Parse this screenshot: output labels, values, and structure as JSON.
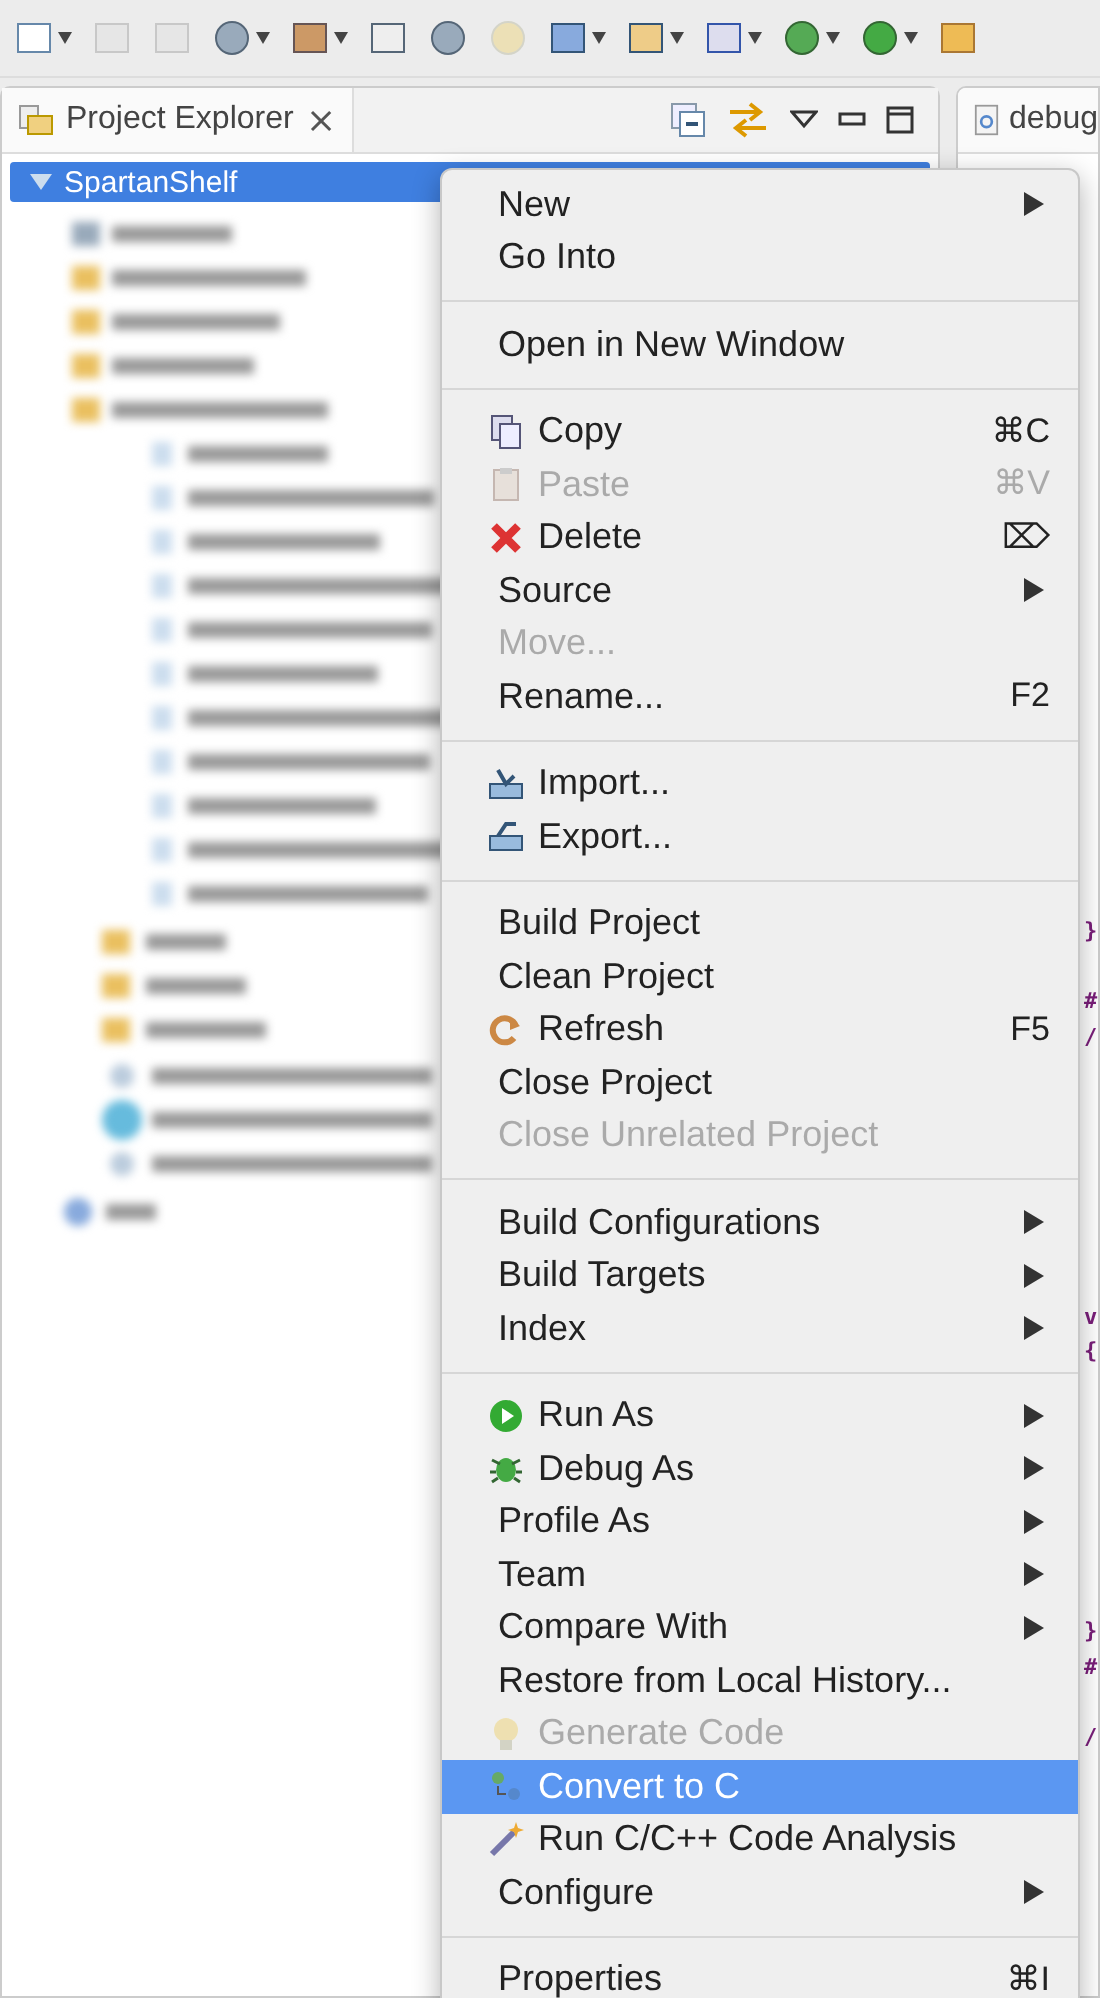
{
  "toolbar": [
    {
      "dropdown": true,
      "disabled": false
    },
    {
      "dropdown": false,
      "disabled": true
    },
    {
      "dropdown": false,
      "disabled": true
    },
    {
      "dropdown": true,
      "disabled": false
    },
    {
      "dropdown": true,
      "disabled": false
    },
    {
      "dropdown": false,
      "disabled": false
    },
    {
      "dropdown": false,
      "disabled": false
    },
    {
      "dropdown": false,
      "disabled": true
    },
    {
      "dropdown": true,
      "disabled": false
    },
    {
      "dropdown": true,
      "disabled": false
    },
    {
      "dropdown": true,
      "disabled": false
    },
    {
      "dropdown": true,
      "disabled": false
    },
    {
      "dropdown": true,
      "disabled": false
    },
    {
      "dropdown": false,
      "disabled": false
    }
  ],
  "view_tab": {
    "title": "Project Explorer",
    "close": "⨯"
  },
  "tree": {
    "root": {
      "label": "SpartanShelf",
      "expanded": true,
      "selected": true
    }
  },
  "editor": {
    "tab": "debug",
    "lines": [
      {
        "kind": "code",
        "text": "}"
      },
      {
        "kind": "blank"
      },
      {
        "kind": "code",
        "text": "#"
      },
      {
        "kind": "code",
        "text": "/"
      },
      {
        "kind": "blank"
      },
      {
        "kind": "blank"
      },
      {
        "kind": "blank"
      },
      {
        "kind": "blank"
      },
      {
        "kind": "blank"
      },
      {
        "kind": "blank"
      },
      {
        "kind": "blank"
      },
      {
        "kind": "code",
        "text": "v"
      },
      {
        "kind": "code",
        "text": "{"
      },
      {
        "kind": "blank"
      },
      {
        "kind": "blank"
      },
      {
        "kind": "blank"
      },
      {
        "kind": "blank"
      },
      {
        "kind": "blank"
      },
      {
        "kind": "blank"
      },
      {
        "kind": "blank"
      },
      {
        "kind": "code",
        "text": "}"
      },
      {
        "kind": "code",
        "text": "#"
      },
      {
        "kind": "blank"
      },
      {
        "kind": "code",
        "text": "/"
      }
    ]
  },
  "context_menu": {
    "sections": [
      {
        "items": [
          {
            "label": "New",
            "submenu": true,
            "disabled": false,
            "selected": false
          },
          {
            "label": "Go Into",
            "disabled": false,
            "selected": false
          }
        ]
      },
      {
        "items": [
          {
            "label": "Open in New Window",
            "disabled": false,
            "selected": false
          }
        ]
      },
      {
        "items": [
          {
            "label": "Copy",
            "shortcut": "⌘C",
            "disabled": false,
            "selected": false
          },
          {
            "label": "Paste",
            "shortcut": "⌘V",
            "disabled": true,
            "selected": false
          },
          {
            "label": "Delete",
            "shortcut": "⌦",
            "disabled": false,
            "selected": false
          },
          {
            "label": "Source",
            "submenu": true,
            "disabled": false,
            "selected": false
          },
          {
            "label": "Move...",
            "disabled": true,
            "selected": false
          },
          {
            "label": "Rename...",
            "shortcut": "F2",
            "disabled": false,
            "selected": false
          }
        ]
      },
      {
        "items": [
          {
            "label": "Import...",
            "disabled": false,
            "selected": false
          },
          {
            "label": "Export...",
            "disabled": false,
            "selected": false
          }
        ]
      },
      {
        "items": [
          {
            "label": "Build Project",
            "disabled": false,
            "selected": false
          },
          {
            "label": "Clean Project",
            "disabled": false,
            "selected": false
          },
          {
            "label": "Refresh",
            "shortcut": "F5",
            "disabled": false,
            "selected": false
          },
          {
            "label": "Close Project",
            "disabled": false,
            "selected": false
          },
          {
            "label": "Close Unrelated Project",
            "disabled": true,
            "selected": false
          }
        ]
      },
      {
        "items": [
          {
            "label": "Build Configurations",
            "submenu": true,
            "disabled": false,
            "selected": false
          },
          {
            "label": "Build Targets",
            "submenu": true,
            "disabled": false,
            "selected": false
          },
          {
            "label": "Index",
            "submenu": true,
            "disabled": false,
            "selected": false
          }
        ]
      },
      {
        "items": [
          {
            "label": "Run As",
            "submenu": true,
            "disabled": false,
            "selected": false
          },
          {
            "label": "Debug As",
            "submenu": true,
            "disabled": false,
            "selected": false
          },
          {
            "label": "Profile As",
            "submenu": true,
            "disabled": false,
            "selected": false
          },
          {
            "label": "Team",
            "submenu": true,
            "disabled": false,
            "selected": false
          },
          {
            "label": "Compare With",
            "submenu": true,
            "disabled": false,
            "selected": false
          },
          {
            "label": "Restore from Local History...",
            "disabled": false,
            "selected": false
          },
          {
            "label": "Generate Code",
            "disabled": true,
            "selected": false
          },
          {
            "label": "Convert to C",
            "disabled": false,
            "selected": true
          },
          {
            "label": "Run C/C++ Code Analysis",
            "disabled": false,
            "selected": false
          },
          {
            "label": "Configure",
            "submenu": true,
            "disabled": false,
            "selected": false
          }
        ]
      },
      {
        "items": [
          {
            "label": "Properties",
            "shortcut": "⌘I",
            "disabled": false,
            "selected": false
          }
        ]
      }
    ]
  }
}
